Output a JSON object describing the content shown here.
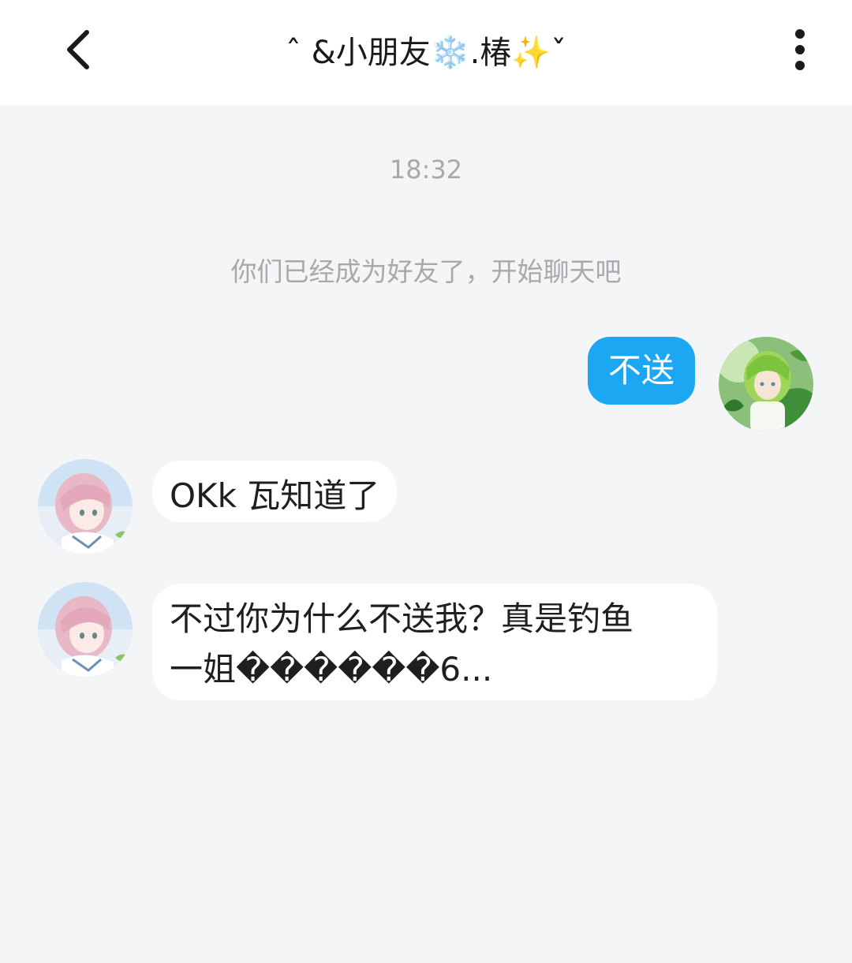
{
  "header": {
    "title": "ˆ &小朋友❄️.椿✨ˇ",
    "back_icon": "chevron-left-icon",
    "more_icon": "vertical-dots-icon"
  },
  "chat": {
    "timestamp": "18:32",
    "system_message": "你们已经成为好友了，开始聊天吧",
    "messages": [
      {
        "from": "me",
        "text": "不送"
      },
      {
        "from": "friend",
        "text": "OKk 瓦知道了"
      },
      {
        "from": "friend",
        "lines": [
          "不过你为什么不送我？真是钓鱼",
          "一姐������6..."
        ]
      }
    ]
  },
  "colors": {
    "outgoing_bubble": "#1ba7f1",
    "incoming_bubble": "#ffffff",
    "background": "#f4f5f7",
    "muted_text": "#a7a9ad"
  }
}
